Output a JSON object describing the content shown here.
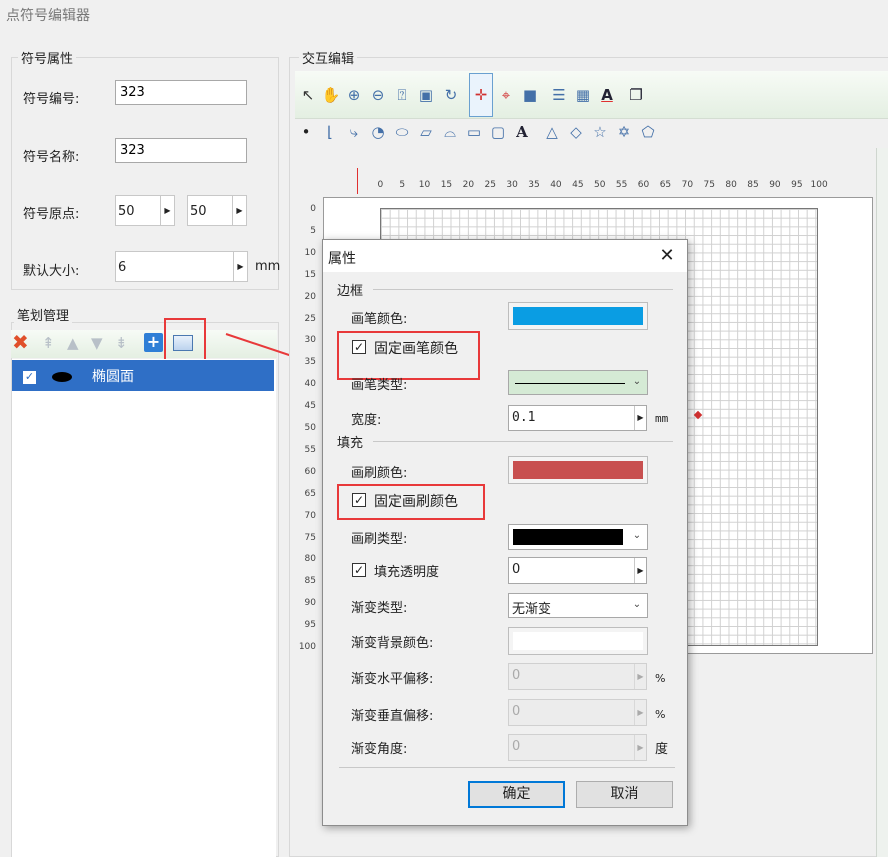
{
  "window": {
    "title": "点符号编辑器"
  },
  "symbol_props": {
    "group_label": "符号属性",
    "code_label": "符号编号:",
    "code_value": "323",
    "name_label": "符号名称:",
    "name_value": "323",
    "origin_label": "符号原点:",
    "origin_x": "50",
    "origin_y": "50",
    "size_label": "默认大小:",
    "size_value": "6",
    "size_unit": "mm"
  },
  "stroke_mgmt": {
    "group_label": "笔划管理",
    "items": [
      {
        "label": "椭圆面",
        "checked": true
      }
    ]
  },
  "interactive": {
    "group_label": "交互编辑",
    "ruler_top": [
      "0",
      "5",
      "10",
      "15",
      "20",
      "25",
      "30",
      "35",
      "40",
      "45",
      "50",
      "55",
      "60",
      "65",
      "70",
      "75",
      "80",
      "85",
      "90",
      "95",
      "100"
    ],
    "ruler_left": [
      "0",
      "5",
      "10",
      "15",
      "20",
      "25",
      "30",
      "35",
      "40",
      "45",
      "50",
      "55",
      "60",
      "65",
      "70",
      "75",
      "80",
      "85",
      "90",
      "95",
      "100"
    ]
  },
  "dialog": {
    "title": "属性",
    "border_section": "边框",
    "pen_color_label": "画笔颜色:",
    "pen_color": "#0a9de3",
    "fixed_pen_label": "固定画笔颜色",
    "pen_type_label": "画笔类型:",
    "width_label": "宽度:",
    "width_value": "0.1",
    "width_unit": "mm",
    "fill_section": "填充",
    "brush_color_label": "画刷颜色:",
    "brush_color": "#c85050",
    "fixed_brush_label": "固定画刷颜色",
    "brush_type_label": "画刷类型:",
    "fill_alpha_label": "填充透明度",
    "fill_alpha_value": "0",
    "grad_type_label": "渐变类型:",
    "grad_type_value": "无渐变",
    "grad_bg_label": "渐变背景颜色:",
    "grad_h_label": "渐变水平偏移:",
    "grad_h_value": "0",
    "grad_h_unit": "%",
    "grad_v_label": "渐变垂直偏移:",
    "grad_v_value": "0",
    "grad_v_unit": "%",
    "grad_angle_label": "渐变角度:",
    "grad_angle_value": "0",
    "grad_angle_unit": "度",
    "ok_label": "确定",
    "cancel_label": "取消"
  },
  "colors": {
    "highlight_red": "#e8393a",
    "selection_blue": "#2f6fc6"
  }
}
